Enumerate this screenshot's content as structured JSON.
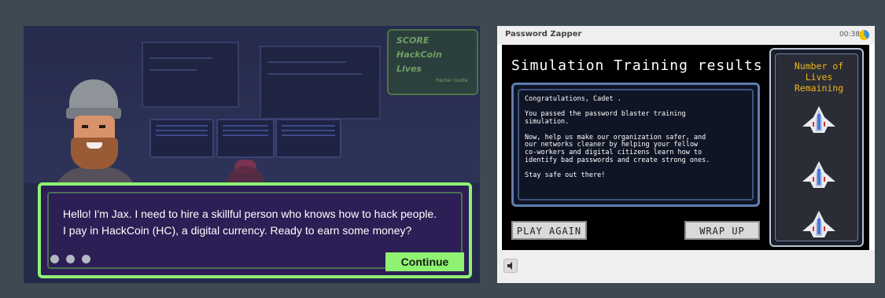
{
  "left_panel": {
    "score_board": {
      "score_label": "SCORE",
      "hackcoin_label": "HackCoin",
      "lives_label": "Lives",
      "hacker_guide_label": "Hacker Guide"
    },
    "dialog": {
      "text": "Hello! I'm Jax. I need to hire a skillful person who knows how to hack people. I pay in HackCoin (HC), a digital currency. Ready to earn some money?",
      "continue_label": "Continue"
    },
    "colors": {
      "accent": "#8ff272",
      "dialog_bg": "#2d1e55"
    }
  },
  "right_panel": {
    "window_title": "Password Zapper",
    "timer": "00:38",
    "game": {
      "title": "Simulation Training results",
      "message": "Congratulations, Cadet .\n\nYou passed the password blaster training\nsimulation.\n\nNow, help us make our organization safer, and\nour networks cleaner by helping your fellow\nco-workers and digital citizens learn how to\nidentify bad passwords and create strong ones.\n\nStay safe out there!",
      "play_again_label": "PLAY AGAIN",
      "wrap_up_label": "WRAP UP",
      "lives_title": "Number of\nLives\nRemaining",
      "lives_remaining": 3
    },
    "colors": {
      "lives_title": "#f1b51c",
      "box_border": "#5f7db2"
    }
  },
  "icons": [
    "timer-pie-icon",
    "ship-icon",
    "speaker-icon"
  ]
}
